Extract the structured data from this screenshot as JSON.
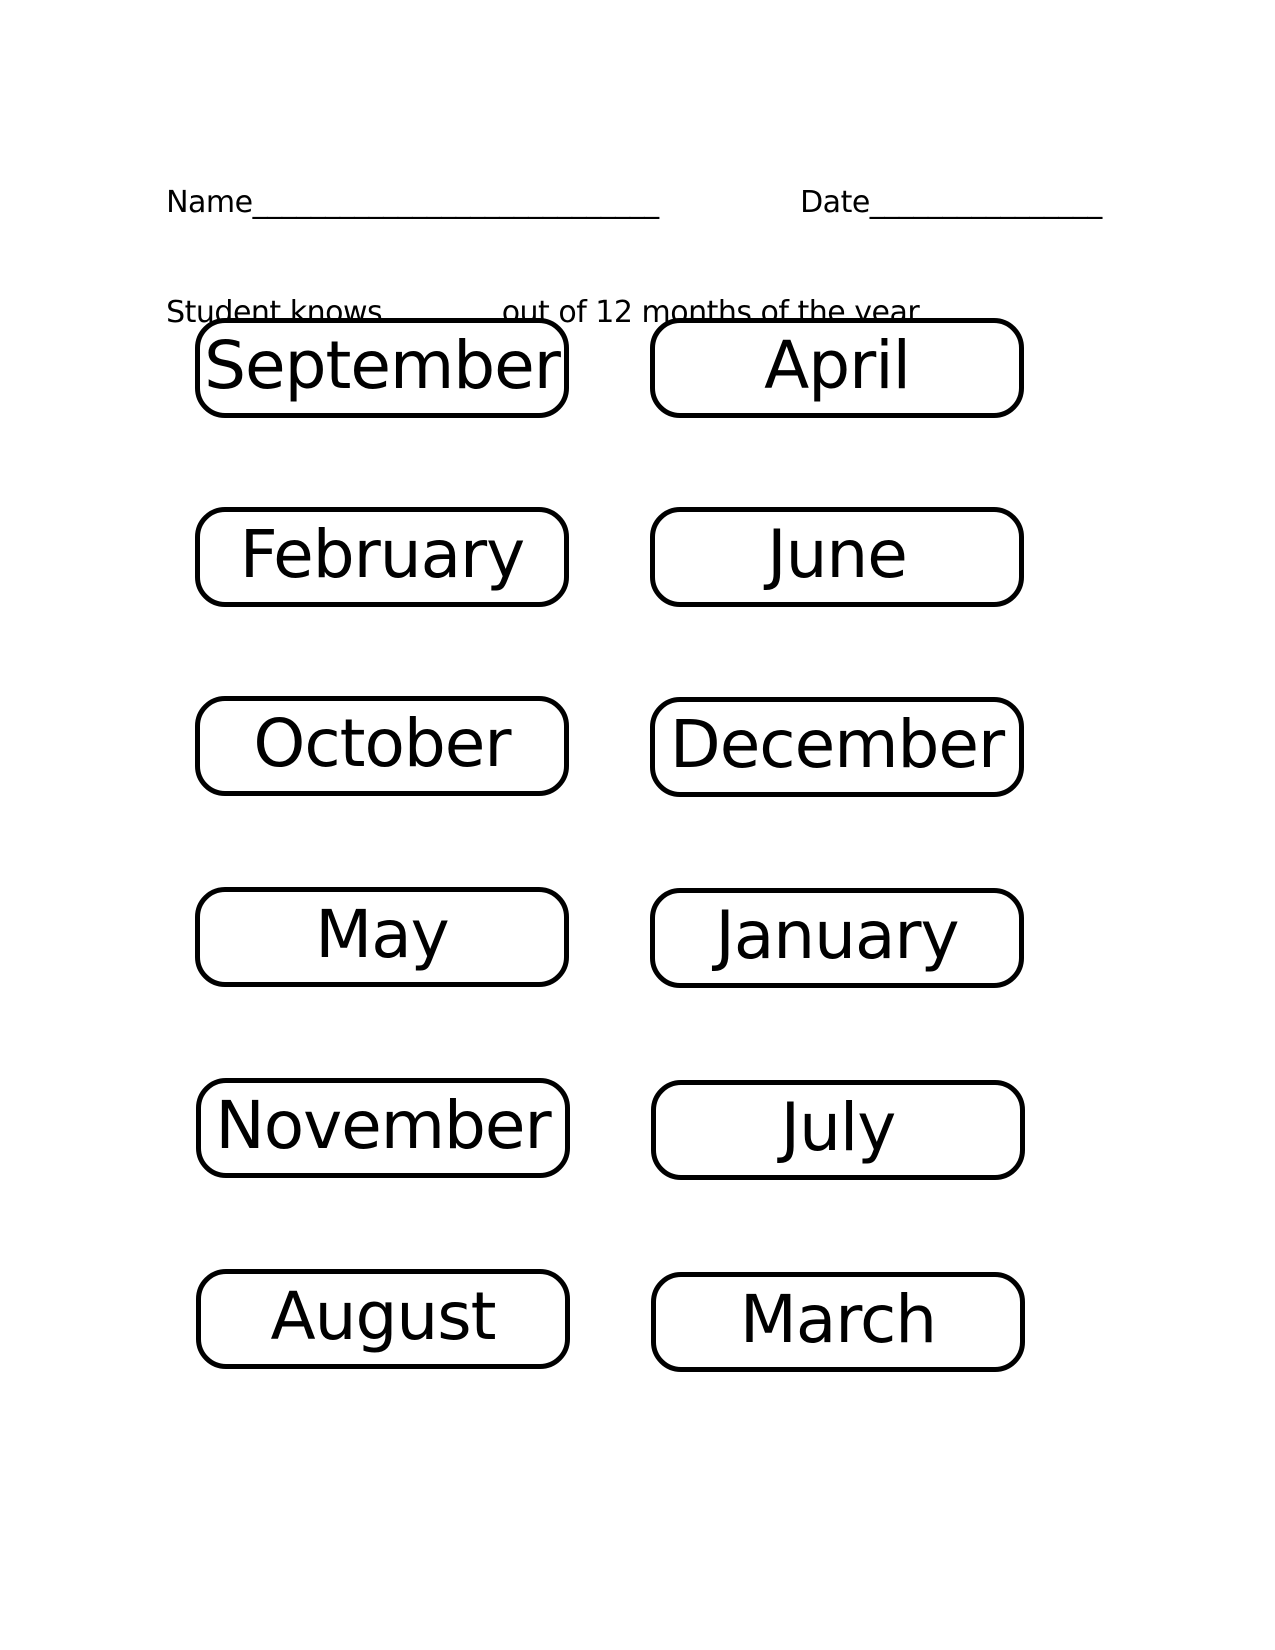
{
  "header": {
    "name_label": "Name",
    "name_blank": "____________________________",
    "date_label": "Date",
    "date_blank": "________________",
    "knows_prefix": "Student knows ",
    "knows_blank": "_______",
    "knows_suffix": " out of 12 months of the year."
  },
  "cards": {
    "left": [
      "September",
      "February",
      "October",
      "May",
      "November",
      "August"
    ],
    "right": [
      "April",
      "June",
      "December",
      "January",
      "July",
      "March"
    ]
  }
}
